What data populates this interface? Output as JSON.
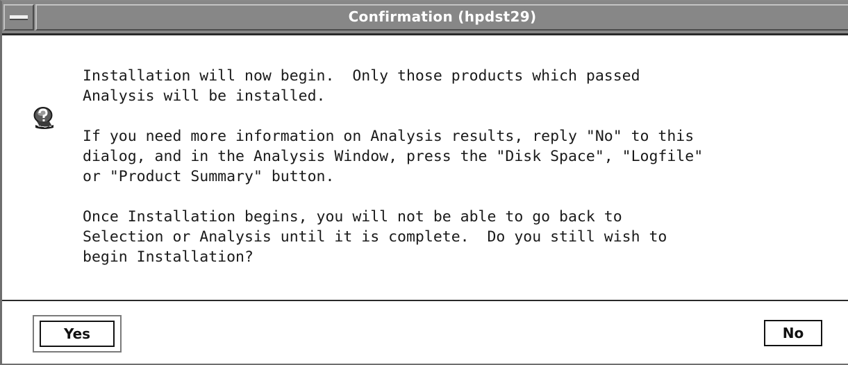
{
  "window": {
    "title": "Confirmation (hpdst29)",
    "sysmenu_icon": "window-menu-icon"
  },
  "dialog": {
    "icon": "question-icon",
    "paragraphs": [
      "Installation will now begin.  Only those products which passed\nAnalysis will be installed.",
      "If you need more information on Analysis results, reply \"No\" to this\ndialog, and in the Analysis Window, press the \"Disk Space\", \"Logfile\"\nor \"Product Summary\" button.",
      "Once Installation begins, you will not be able to go back to\nSelection or Analysis until it is complete.  Do you still wish to\nbegin Installation?"
    ]
  },
  "buttons": {
    "yes_label": "Yes",
    "no_label": "No",
    "default": "yes"
  },
  "colors": {
    "titlebar": "#878787",
    "title_text": "#ffffff",
    "background": "#ffffff",
    "text": "#1a1a1a"
  }
}
